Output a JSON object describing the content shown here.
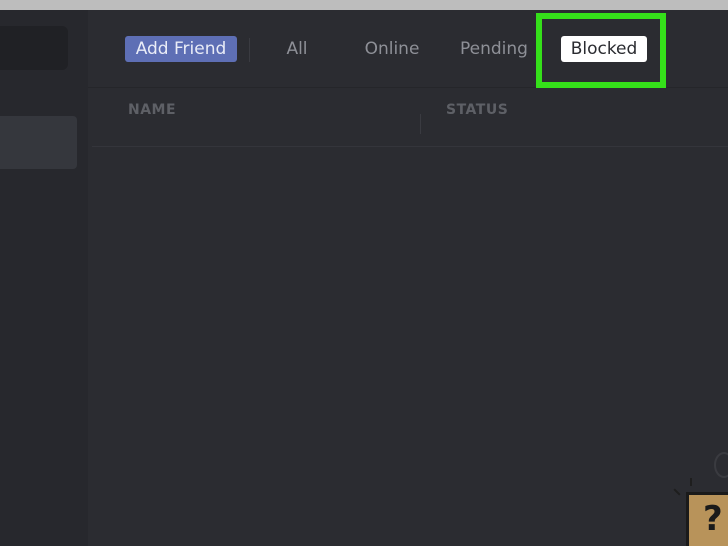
{
  "tabs": {
    "add_friend": "Add Friend",
    "all": "All",
    "online": "Online",
    "pending": "Pending",
    "blocked": "Blocked"
  },
  "table": {
    "columns": [
      "NAME",
      "STATUS"
    ]
  },
  "icons": {
    "help": "question-mark-icon",
    "gift": "gift-icon"
  },
  "colors": {
    "accent": "#5e6fb5",
    "highlight": "#35e01a",
    "background": "#2b2c31"
  }
}
